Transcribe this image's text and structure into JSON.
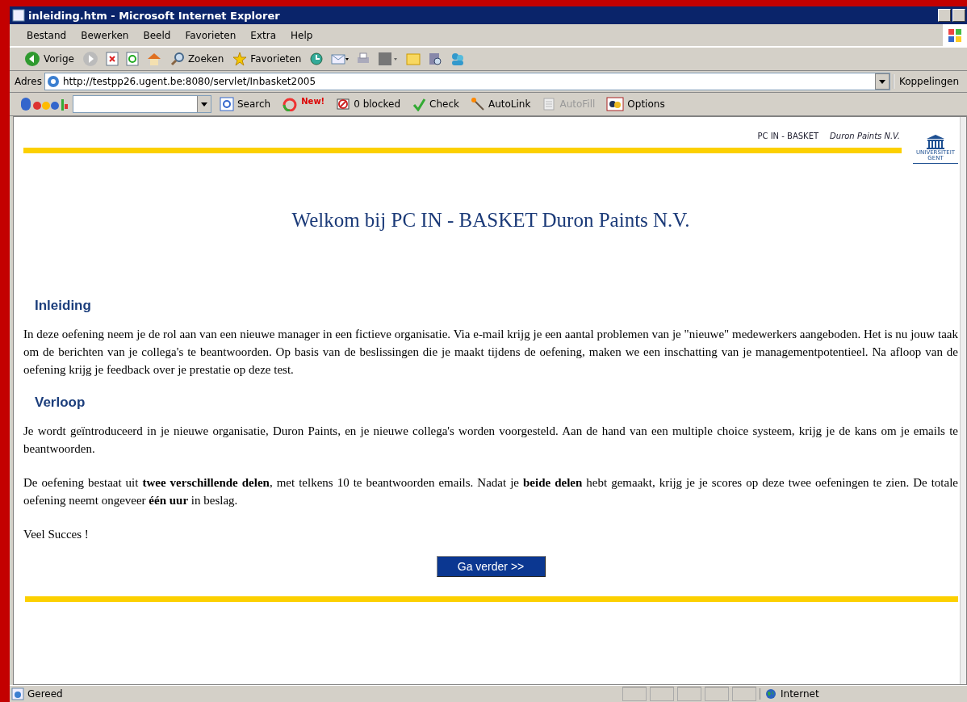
{
  "window": {
    "title": "inleiding.htm - Microsoft Internet Explorer"
  },
  "menu": [
    "Bestand",
    "Bewerken",
    "Beeld",
    "Favorieten",
    "Extra",
    "Help"
  ],
  "toolbar": [
    {
      "kind": "back",
      "label": "Vorige"
    },
    {
      "kind": "forward"
    },
    {
      "kind": "stop"
    },
    {
      "kind": "refresh"
    },
    {
      "kind": "home"
    },
    {
      "kind": "search",
      "label": "Zoeken"
    },
    {
      "kind": "favorites",
      "label": "Favorieten"
    },
    {
      "kind": "history"
    },
    {
      "kind": "mail"
    },
    {
      "kind": "print"
    },
    {
      "kind": "edit"
    },
    {
      "kind": "folder"
    },
    {
      "kind": "research"
    },
    {
      "kind": "messenger"
    }
  ],
  "address": {
    "label": "Adres",
    "value": "http://testpp26.ugent.be:8080/servlet/Inbasket2005",
    "links": "Koppelingen"
  },
  "google_toolbar": {
    "search": "Search",
    "items": [
      {
        "kind": "new",
        "label": "New!"
      },
      {
        "kind": "popup",
        "label": "0 blocked"
      },
      {
        "kind": "check",
        "label": "Check"
      },
      {
        "kind": "autolink",
        "label": "AutoLink"
      },
      {
        "kind": "autofill",
        "label": "AutoFill",
        "disabled": true
      },
      {
        "kind": "options",
        "label": "Options"
      }
    ]
  },
  "page": {
    "header": "PC IN - BASKET",
    "header_company": "Duron Paints N.V.",
    "logo": [
      "UNIVERSITEIT",
      "GENT"
    ],
    "title": "Welkom bij PC IN - BASKET Duron Paints N.V.",
    "sections": [
      {
        "heading": "Inleiding",
        "paragraphs": [
          "In deze oefening neem je de rol aan van een nieuwe manager in een fictieve organisatie. Via e-mail krijg je een aantal problemen van je \"nieuwe\" medewerkers aangeboden. Het is nu jouw taak om de berichten van je collega's te beantwoorden. Op basis van de beslissingen die je maakt tijdens de oefening, maken we een inschatting van je managementpotentieel. Na afloop van de oefening krijg je feedback over je prestatie op deze test."
        ]
      },
      {
        "heading": "Verloop",
        "paragraphs": [
          "Je wordt geïntroduceerd in je nieuwe organisatie, Duron Paints, en je nieuwe collega's worden voorgesteld. Aan de hand van een multiple choice systeem, krijg je de kans om je emails te beantwoorden.",
          "De oefening bestaat uit **twee verschillende delen**, met telkens 10 te beantwoorden emails. Nadat je **beide delen** hebt gemaakt, krijg je je scores op deze twee oefeningen te zien. De totale oefening neemt ongeveer **één uur** in beslag.",
          "Veel Succes !"
        ]
      }
    ],
    "button": "Ga verder >>"
  },
  "status_bar": {
    "text": "Gereed",
    "zone": "Internet"
  }
}
